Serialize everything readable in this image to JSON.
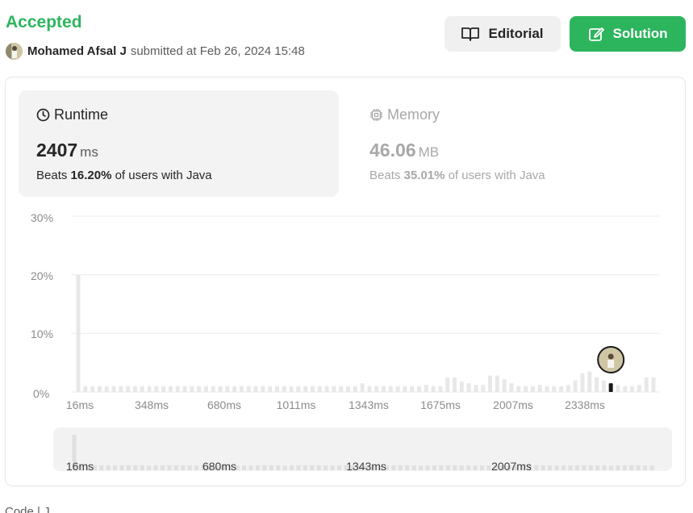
{
  "submission": {
    "status": "Accepted",
    "username": "Mohamed Afsal J",
    "submitted_text": "submitted at Feb 26, 2024 15:48"
  },
  "buttons": {
    "editorial": "Editorial",
    "solution": "Solution"
  },
  "runtime": {
    "title": "Runtime",
    "value": "2407",
    "unit": "ms",
    "beats_prefix": "Beats",
    "beats_percent": "16.20%",
    "beats_suffix": "of users with Java"
  },
  "memory": {
    "title": "Memory",
    "value": "46.06",
    "unit": "MB",
    "beats_prefix": "Beats",
    "beats_percent": "35.01%",
    "beats_suffix": "of users with Java"
  },
  "chart_data": {
    "type": "bar",
    "ylabel": "",
    "xlabel": "",
    "y_ticks": [
      "30%",
      "20%",
      "10%",
      "0%"
    ],
    "ylim": [
      0,
      30
    ],
    "x_tick_labels": [
      "16ms",
      "348ms",
      "680ms",
      "1011ms",
      "1343ms",
      "1675ms",
      "2007ms",
      "2338ms"
    ],
    "values": [
      20,
      1,
      1,
      1,
      1,
      1,
      1,
      1,
      1,
      1,
      1,
      1,
      1,
      1,
      1,
      1,
      1,
      1,
      1,
      1,
      1,
      1,
      1,
      1,
      1,
      1,
      1,
      1,
      1,
      1,
      1,
      1,
      1,
      1,
      1,
      1,
      1,
      1,
      1,
      1,
      1.5,
      1,
      1,
      1,
      1,
      1,
      1,
      1,
      1,
      1.2,
      1,
      1,
      2.5,
      2.5,
      1.8,
      1.5,
      1.2,
      1.2,
      2.8,
      2.8,
      2.2,
      1.5,
      1,
      1,
      1,
      1.2,
      1,
      1,
      1,
      1.2,
      2,
      3.2,
      3.5,
      2.5,
      2,
      1.5,
      1.2,
      1,
      1,
      1.2,
      2.5,
      2.5
    ],
    "highlight_index": 75,
    "highlight_label": "user's runtime",
    "overview_tick_labels": [
      "16ms",
      "680ms",
      "1343ms",
      "2007ms"
    ]
  },
  "colors": {
    "accent_green": "#2db55d",
    "bar": "#e8e8e8",
    "bar_highlight": "#1a1a1a"
  },
  "footer": {
    "code_label": "Code | J"
  }
}
